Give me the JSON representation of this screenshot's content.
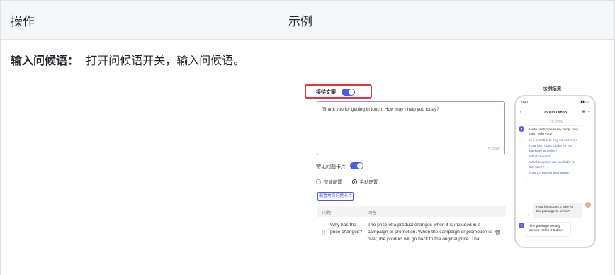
{
  "table": {
    "headers": [
      "操作",
      "示例"
    ],
    "row": {
      "title": "输入问候语：",
      "text": "打开问候语开关，输入问候语。"
    }
  },
  "example": {
    "greeting_label": "接待文案",
    "greeting_text": "Thank you for getting in touch. How may I help you today?",
    "counter": "57/500",
    "faq_label": "常见问题卡片",
    "radio_smart": "智能配置",
    "radio_manual": "手动配置",
    "config_button": "配置常见问题卡片",
    "col_question": "问题",
    "col_answer": "回答",
    "faq_question": "Why has the price changed?",
    "faq_answer": "The price of a product changes when it is included in a campaign or promotion. When the campaign or promotion is over, the product will go back to the original price. That",
    "accent_color": "#4c5ae6",
    "highlight_color": "#e2363b"
  },
  "phone": {
    "title": "示例结果",
    "clock": "9:41",
    "shop_name": "DouDou shop",
    "timestamp": "15:27 PM",
    "welcome": "Hello, welcome to my shop, how can I help you?",
    "questions": [
      "Is it possible to pay on delivery?",
      "How long does it take for the package to arrive?",
      "What course?",
      "What coupons are available in the store?",
      "How to request exchange?"
    ],
    "user_msg": "How long does it take for the package to arrive?",
    "reply": "The package usually arrives within 3-5 days"
  }
}
